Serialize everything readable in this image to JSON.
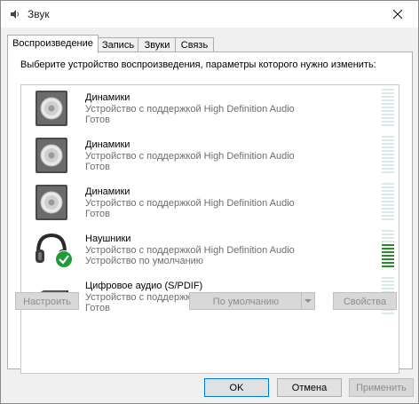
{
  "window": {
    "title": "Звук",
    "icon": "speaker-app-icon",
    "close_icon": "close-icon"
  },
  "tabs": [
    {
      "label": "Воспроизведение",
      "active": true
    },
    {
      "label": "Запись",
      "active": false
    },
    {
      "label": "Звуки",
      "active": false
    },
    {
      "label": "Связь",
      "active": false
    }
  ],
  "instruction": "Выберите устройство воспроизведения, параметры которого нужно изменить:",
  "devices": [
    {
      "name": "Динамики",
      "description": "Устройство с поддержкой High Definition Audio",
      "status": "Готов",
      "icon": "speaker-icon",
      "level": 0
    },
    {
      "name": "Динамики",
      "description": "Устройство с поддержкой High Definition Audio",
      "status": "Готов",
      "icon": "speaker-icon",
      "level": 0
    },
    {
      "name": "Динамики",
      "description": "Устройство с поддержкой High Definition Audio",
      "status": "Готов",
      "icon": "speaker-icon",
      "level": 0
    },
    {
      "name": "Наушники",
      "description": "Устройство с поддержкой High Definition Audio",
      "status": "Устройство по умолчанию",
      "icon": "headphones-icon",
      "default_badge_icon": "default-check-icon",
      "level": 0.6
    },
    {
      "name": "Цифровое аудио (S/PDIF)",
      "description": "Устройство с поддержкой High Definition Audio",
      "status": "Готов",
      "icon": "spdif-device-icon",
      "level": 0
    }
  ],
  "buttons": {
    "configure": "Настроить",
    "set_default": "По умолчанию",
    "properties": "Свойства",
    "ok": "OK",
    "cancel": "Отмена",
    "apply": "Применить"
  },
  "colors": {
    "meter_on": "#2a8c2a",
    "meter_off": "#d9e8e8",
    "default_badge": "#1e9c3a"
  }
}
